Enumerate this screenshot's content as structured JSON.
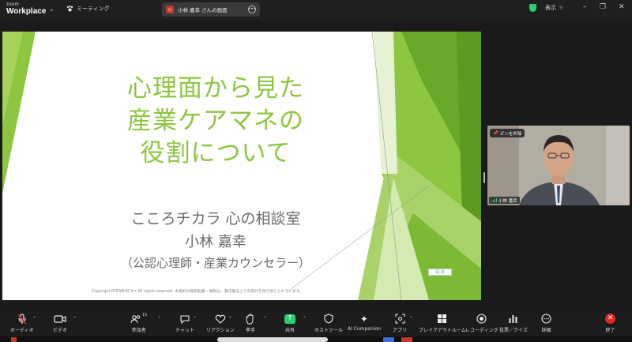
{
  "app": {
    "brand_small": "zoom",
    "brand_big": "Workplace"
  },
  "topbar": {
    "meeting_label": "ミーティング",
    "share_pill": {
      "avatar_text": "小",
      "label": "小林 嘉幸 さんの画面"
    },
    "view_label": "表示"
  },
  "slide": {
    "title_lines": [
      "心理面から見た",
      "産業ケアマネの",
      "役割について"
    ],
    "subtitle_1": "こころチカラ 心の相談室",
    "subtitle_2": "小林 嘉幸",
    "subtitle_3": "（公認心理師・産業カウンセラー）",
    "copyright": "Copyright RITAWIHZ Inc.All rights reserved. 本資料の無断転載・複製は、著作権法上での例外を除き禁じられています。",
    "logo_text": "図 運"
  },
  "video": {
    "pin_label": "ピンを外除",
    "name": "小林 嘉幸"
  },
  "toolbar": {
    "audio": "オーディオ",
    "video": "ビデオ",
    "participants": "参加者",
    "participants_count": "15",
    "chat": "チャット",
    "reactions": "リアクション",
    "raise_hand": "挙手",
    "share": "共有",
    "host_tools": "ホストツール",
    "ai_companion": "AI Companion",
    "apps": "アプリ",
    "breakout": "ブレイクアウトルーム",
    "recording": "レコーディング",
    "polls": "投票／クイズ",
    "more": "詳細",
    "end": "終了"
  },
  "colors": {
    "accent_green": "#8dc63f",
    "share_green": "#2ecc71",
    "end_red": "#e02828"
  },
  "icons": [
    "mic-muted-icon",
    "camera-icon",
    "participants-icon",
    "chat-icon",
    "heart-icon",
    "hand-icon",
    "share-arrow-icon",
    "shield-icon",
    "sparkle-icon",
    "apps-icon",
    "grid-icon",
    "record-icon",
    "poll-icon",
    "more-icon",
    "close-icon"
  ]
}
